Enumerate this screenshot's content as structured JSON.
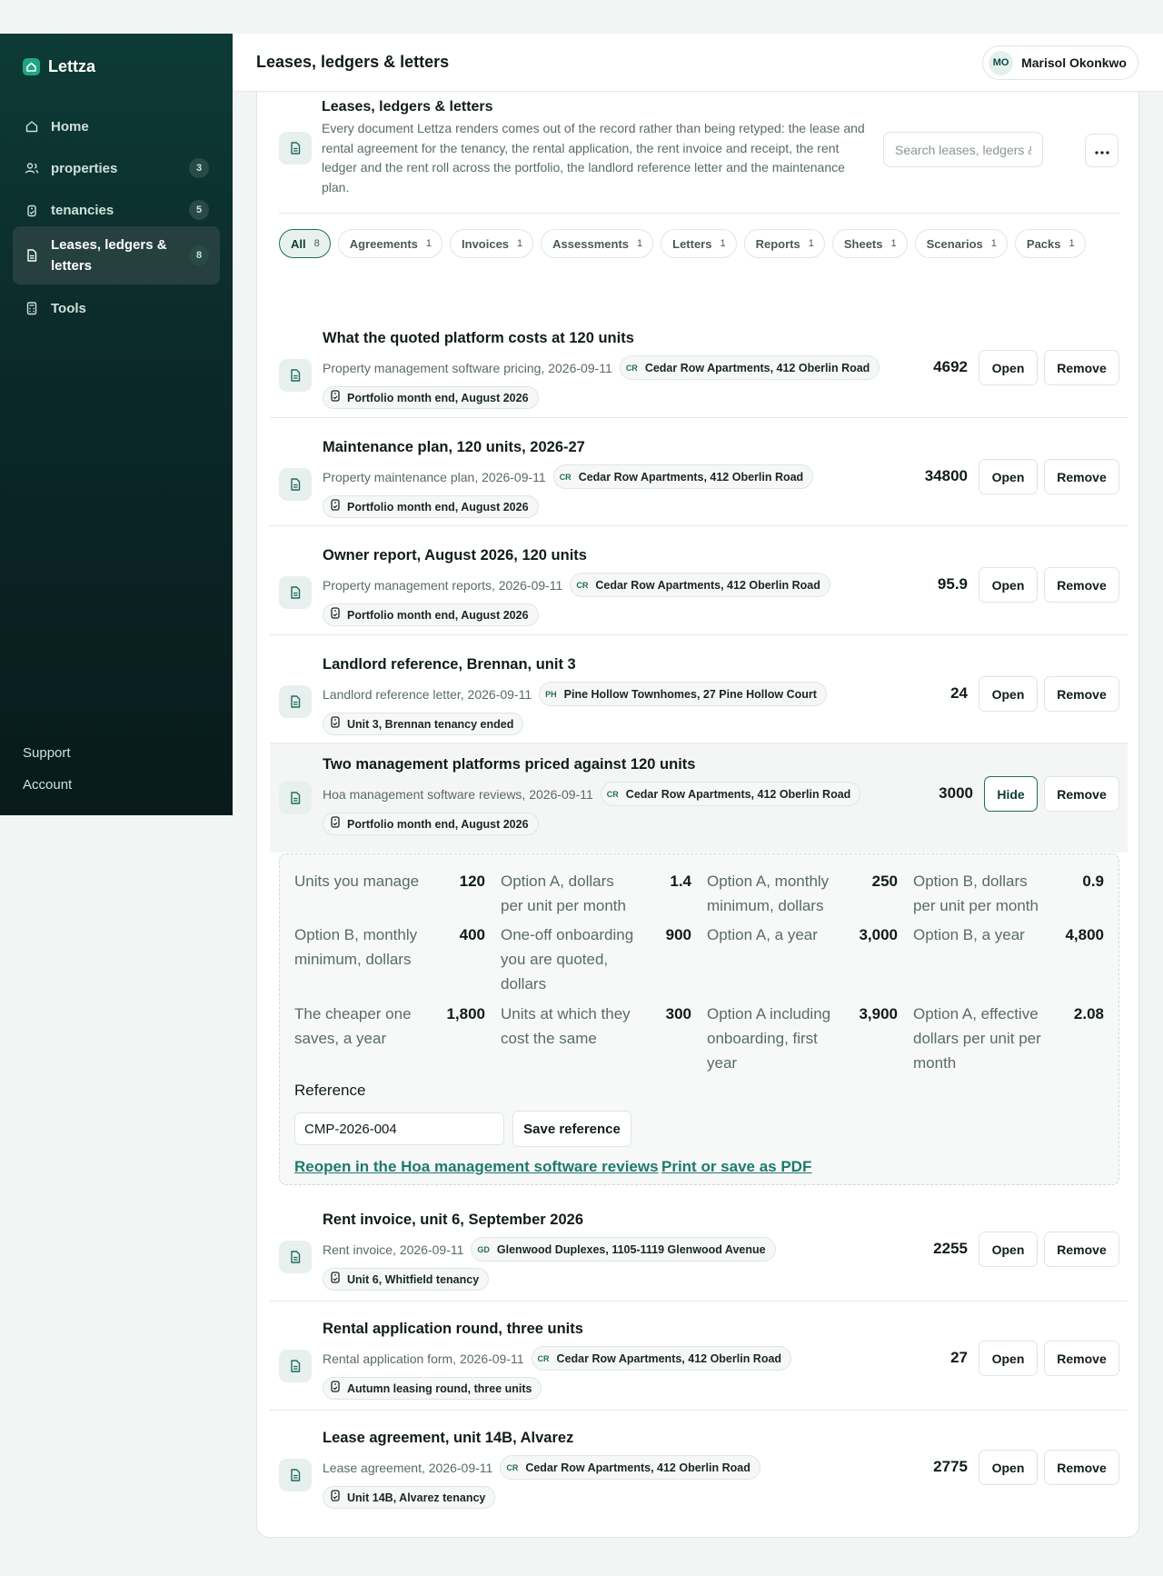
{
  "app": {
    "name": "Lettza"
  },
  "sidebar": {
    "items": [
      {
        "label": "Home",
        "icon": "home-icon"
      },
      {
        "label": "properties",
        "count": "3",
        "icon": "people-icon"
      },
      {
        "label": "tenancies",
        "count": "5",
        "icon": "tag-icon"
      },
      {
        "label": "Leases, ledgers & letters",
        "count": "8",
        "icon": "document-icon",
        "active": true
      },
      {
        "label": "Tools",
        "icon": "calculator-icon"
      }
    ],
    "footer": {
      "support": "Support",
      "account": "Account"
    }
  },
  "header": {
    "title": "Leases, ledgers & letters",
    "user": {
      "initials": "MO",
      "name": "Marisol Okonkwo"
    }
  },
  "intro": {
    "title": "Leases, ledgers & letters",
    "description": "Every document Lettza renders comes out of the record rather than being retyped: the lease and rental agreement for the tenancy, the rental application, the rent invoice and receipt, the rent ledger and the rent roll across the portfolio, the landlord reference letter and the maintenance plan.",
    "search_placeholder": "Search leases, ledgers & letters"
  },
  "filters": [
    {
      "label": "All",
      "count": "8",
      "active": true
    },
    {
      "label": "Agreements",
      "count": "1"
    },
    {
      "label": "Invoices",
      "count": "1"
    },
    {
      "label": "Assessments",
      "count": "1"
    },
    {
      "label": "Letters",
      "count": "1"
    },
    {
      "label": "Reports",
      "count": "1"
    },
    {
      "label": "Sheets",
      "count": "1"
    },
    {
      "label": "Scenarios",
      "count": "1"
    },
    {
      "label": "Packs",
      "count": "1"
    }
  ],
  "documents": [
    {
      "title": "What the quoted platform costs at 120 units",
      "meta": "Property management software pricing, 2026-09-11",
      "property_abbr": "CR",
      "property": "Cedar Row Apartments, 412 Oberlin Road",
      "tag": "Portfolio month end, August 2026",
      "value": "4692",
      "open_label": "Open",
      "remove_label": "Remove"
    },
    {
      "title": "Maintenance plan, 120 units, 2026-27",
      "meta": "Property maintenance plan, 2026-09-11",
      "property_abbr": "CR",
      "property": "Cedar Row Apartments, 412 Oberlin Road",
      "tag": "Portfolio month end, August 2026",
      "value": "34800",
      "open_label": "Open",
      "remove_label": "Remove"
    },
    {
      "title": "Owner report, August 2026, 120 units",
      "meta": "Property management reports, 2026-09-11",
      "property_abbr": "CR",
      "property": "Cedar Row Apartments, 412 Oberlin Road",
      "tag": "Portfolio month end, August 2026",
      "value": "95.9",
      "open_label": "Open",
      "remove_label": "Remove"
    },
    {
      "title": "Landlord reference, Brennan, unit 3",
      "meta": "Landlord reference letter, 2026-09-11",
      "property_abbr": "PH",
      "property": "Pine Hollow Townhomes, 27 Pine Hollow Court",
      "tag": "Unit 3, Brennan tenancy ended",
      "value": "24",
      "open_label": "Open",
      "remove_label": "Remove"
    },
    {
      "title": "Two management platforms priced against 120 units",
      "meta": "Hoa management software reviews, 2026-09-11",
      "property_abbr": "CR",
      "property": "Cedar Row Apartments, 412 Oberlin Road",
      "tag": "Portfolio month end, August 2026",
      "value": "3000",
      "open_label": "Hide",
      "remove_label": "Remove"
    },
    {
      "title": "Rent invoice, unit 6, September 2026",
      "meta": "Rent invoice, 2026-09-11",
      "property_abbr": "GD",
      "property": "Glenwood Duplexes, 1105-1119 Glenwood Avenue",
      "tag": "Unit 6, Whitfield tenancy",
      "value": "2255",
      "open_label": "Open",
      "remove_label": "Remove"
    },
    {
      "title": "Rental application round, three units",
      "meta": "Rental application form, 2026-09-11",
      "property_abbr": "CR",
      "property": "Cedar Row Apartments, 412 Oberlin Road",
      "tag": "Autumn leasing round, three units",
      "value": "27",
      "open_label": "Open",
      "remove_label": "Remove"
    },
    {
      "title": "Lease agreement, unit 14B, Alvarez",
      "meta": "Lease agreement, 2026-09-11",
      "property_abbr": "CR",
      "property": "Cedar Row Apartments, 412 Oberlin Road",
      "tag": "Unit 14B, Alvarez tenancy",
      "value": "2775",
      "open_label": "Open",
      "remove_label": "Remove"
    }
  ],
  "expanded": {
    "fields": [
      {
        "label": "Units you manage",
        "value": "120"
      },
      {
        "label": "Option A, dollars per unit per month",
        "value": "1.4"
      },
      {
        "label": "Option A, monthly minimum, dollars",
        "value": "250"
      },
      {
        "label": "Option B, dollars per unit per month",
        "value": "0.9"
      },
      {
        "label": "Option B, monthly minimum, dollars",
        "value": "400"
      },
      {
        "label": "One-off onboarding you are quoted, dollars",
        "value": "900"
      },
      {
        "label": "Option A, a year",
        "value": "3,000"
      },
      {
        "label": "Option B, a year",
        "value": "4,800"
      },
      {
        "label": "The cheaper one saves, a year",
        "value": "1,800"
      },
      {
        "label": "Units at which they cost the same",
        "value": "300"
      },
      {
        "label": "Option A including onboarding, first year",
        "value": "3,900"
      },
      {
        "label": "Option A, effective dollars per unit per month",
        "value": "2.08"
      }
    ],
    "reference_label": "Reference",
    "reference_value": "CMP-2026-004",
    "save_label": "Save reference",
    "reopen_link": "Reopen in the Hoa management software reviews",
    "print_link": "Print or save as PDF"
  }
}
